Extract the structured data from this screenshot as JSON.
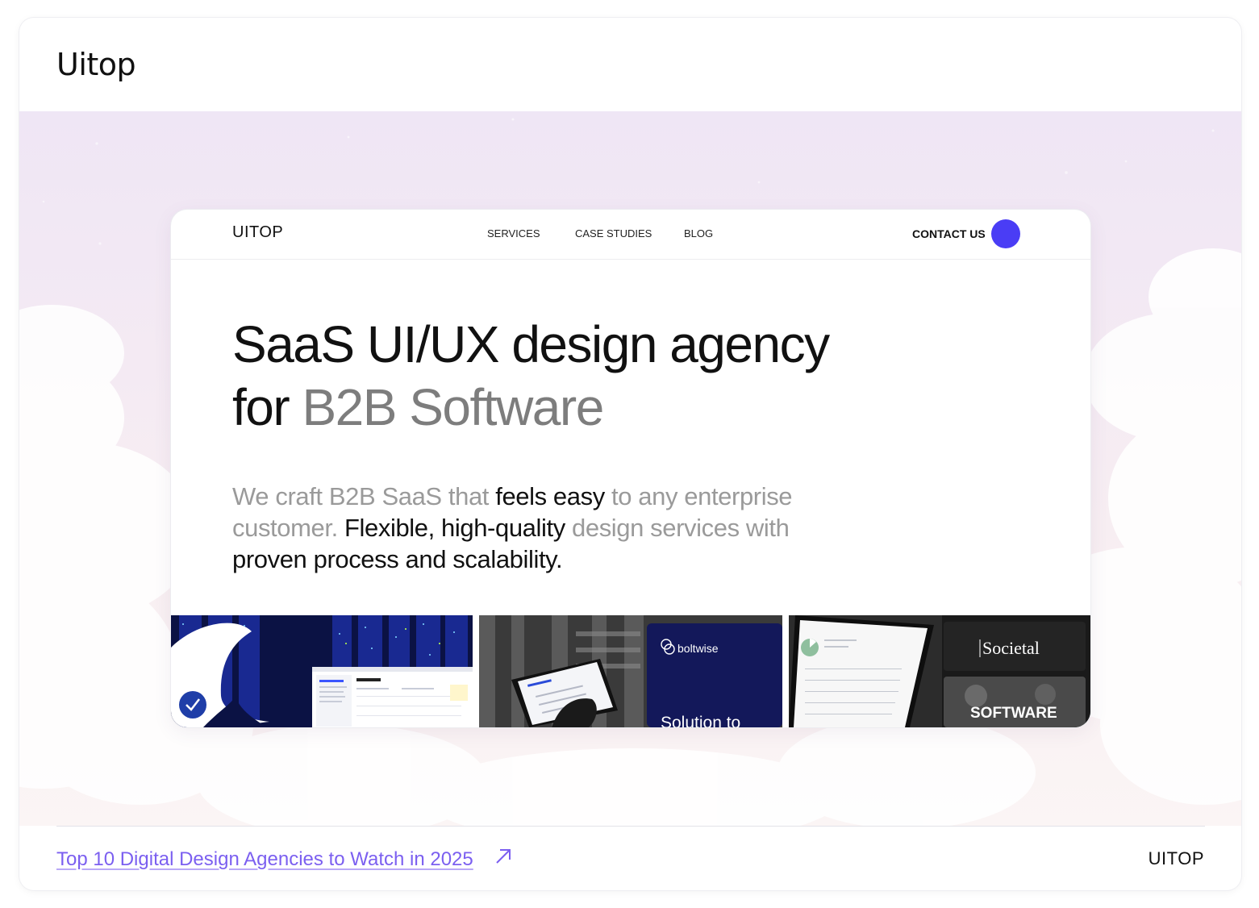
{
  "card": {
    "title": "Uitop"
  },
  "site": {
    "logo": "UITOP",
    "nav": {
      "services": "SERVICES",
      "case_studies": "CASE STUDIES",
      "blog": "BLOG",
      "contact": "CONTACT US"
    },
    "headline": {
      "line1": "SaaS UI/UX design agency",
      "line2_prefix": "for ",
      "line2_highlight": "B2B Software"
    },
    "subheadline": {
      "p1": "We craft B2B SaaS that ",
      "p2": "feels easy",
      "p3": " to any enterprise customer. ",
      "p4": "Flexible, high-quality",
      "p5": " design services with ",
      "p6": "proven process and scalability."
    },
    "thumbnails": {
      "dashboard_title": "Dashboard",
      "boltwise_logo": "boltwise",
      "boltwise_caption": "Solution to",
      "societal_logo": "Societal",
      "societal_caption": "SOFTWARE"
    }
  },
  "footer": {
    "link": "Top 10 Digital Design Agencies to Watch in 2025",
    "brand": "UITOP"
  },
  "colors": {
    "accent": "#4a3df5",
    "link": "#7b5ff0",
    "muted_text": "#9a9a9a"
  },
  "icons": {
    "contact": "blue-dot-icon",
    "footer_link": "arrow-up-right-icon",
    "badge": "checkmark-badge-icon"
  }
}
